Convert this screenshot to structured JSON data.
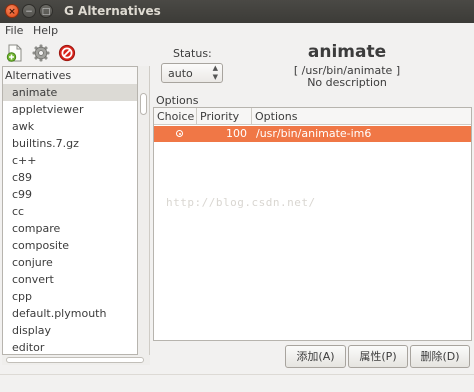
{
  "window": {
    "title": "G Alternatives"
  },
  "menu": {
    "items": [
      "File",
      "Help"
    ]
  },
  "toolbar": {
    "icons": [
      "add-icon",
      "gear-icon",
      "remove-icon"
    ]
  },
  "sidebar": {
    "header": "Alternatives",
    "items": [
      "animate",
      "appletviewer",
      "awk",
      "builtins.7.gz",
      "c++",
      "c89",
      "c99",
      "cc",
      "compare",
      "composite",
      "conjure",
      "convert",
      "cpp",
      "default.plymouth",
      "display",
      "editor"
    ],
    "selected": "animate"
  },
  "status": {
    "label": "Status:",
    "value": "auto"
  },
  "alternative": {
    "name": "animate",
    "link": "[ /usr/bin/animate ]",
    "description": "No description"
  },
  "options": {
    "label": "Options",
    "columns": [
      "Choice",
      "Priority",
      "Options"
    ],
    "rows": [
      {
        "priority": "100",
        "path": "/usr/bin/animate-im6",
        "selected": true
      }
    ]
  },
  "buttons": {
    "add": "添加(A)",
    "properties": "属性(P)",
    "delete": "删除(D)"
  },
  "watermark": "http://blog.csdn.net/",
  "colors": {
    "selection": "#f07746",
    "titlebar": "#3c3b37",
    "close_button": "#df4a16"
  }
}
